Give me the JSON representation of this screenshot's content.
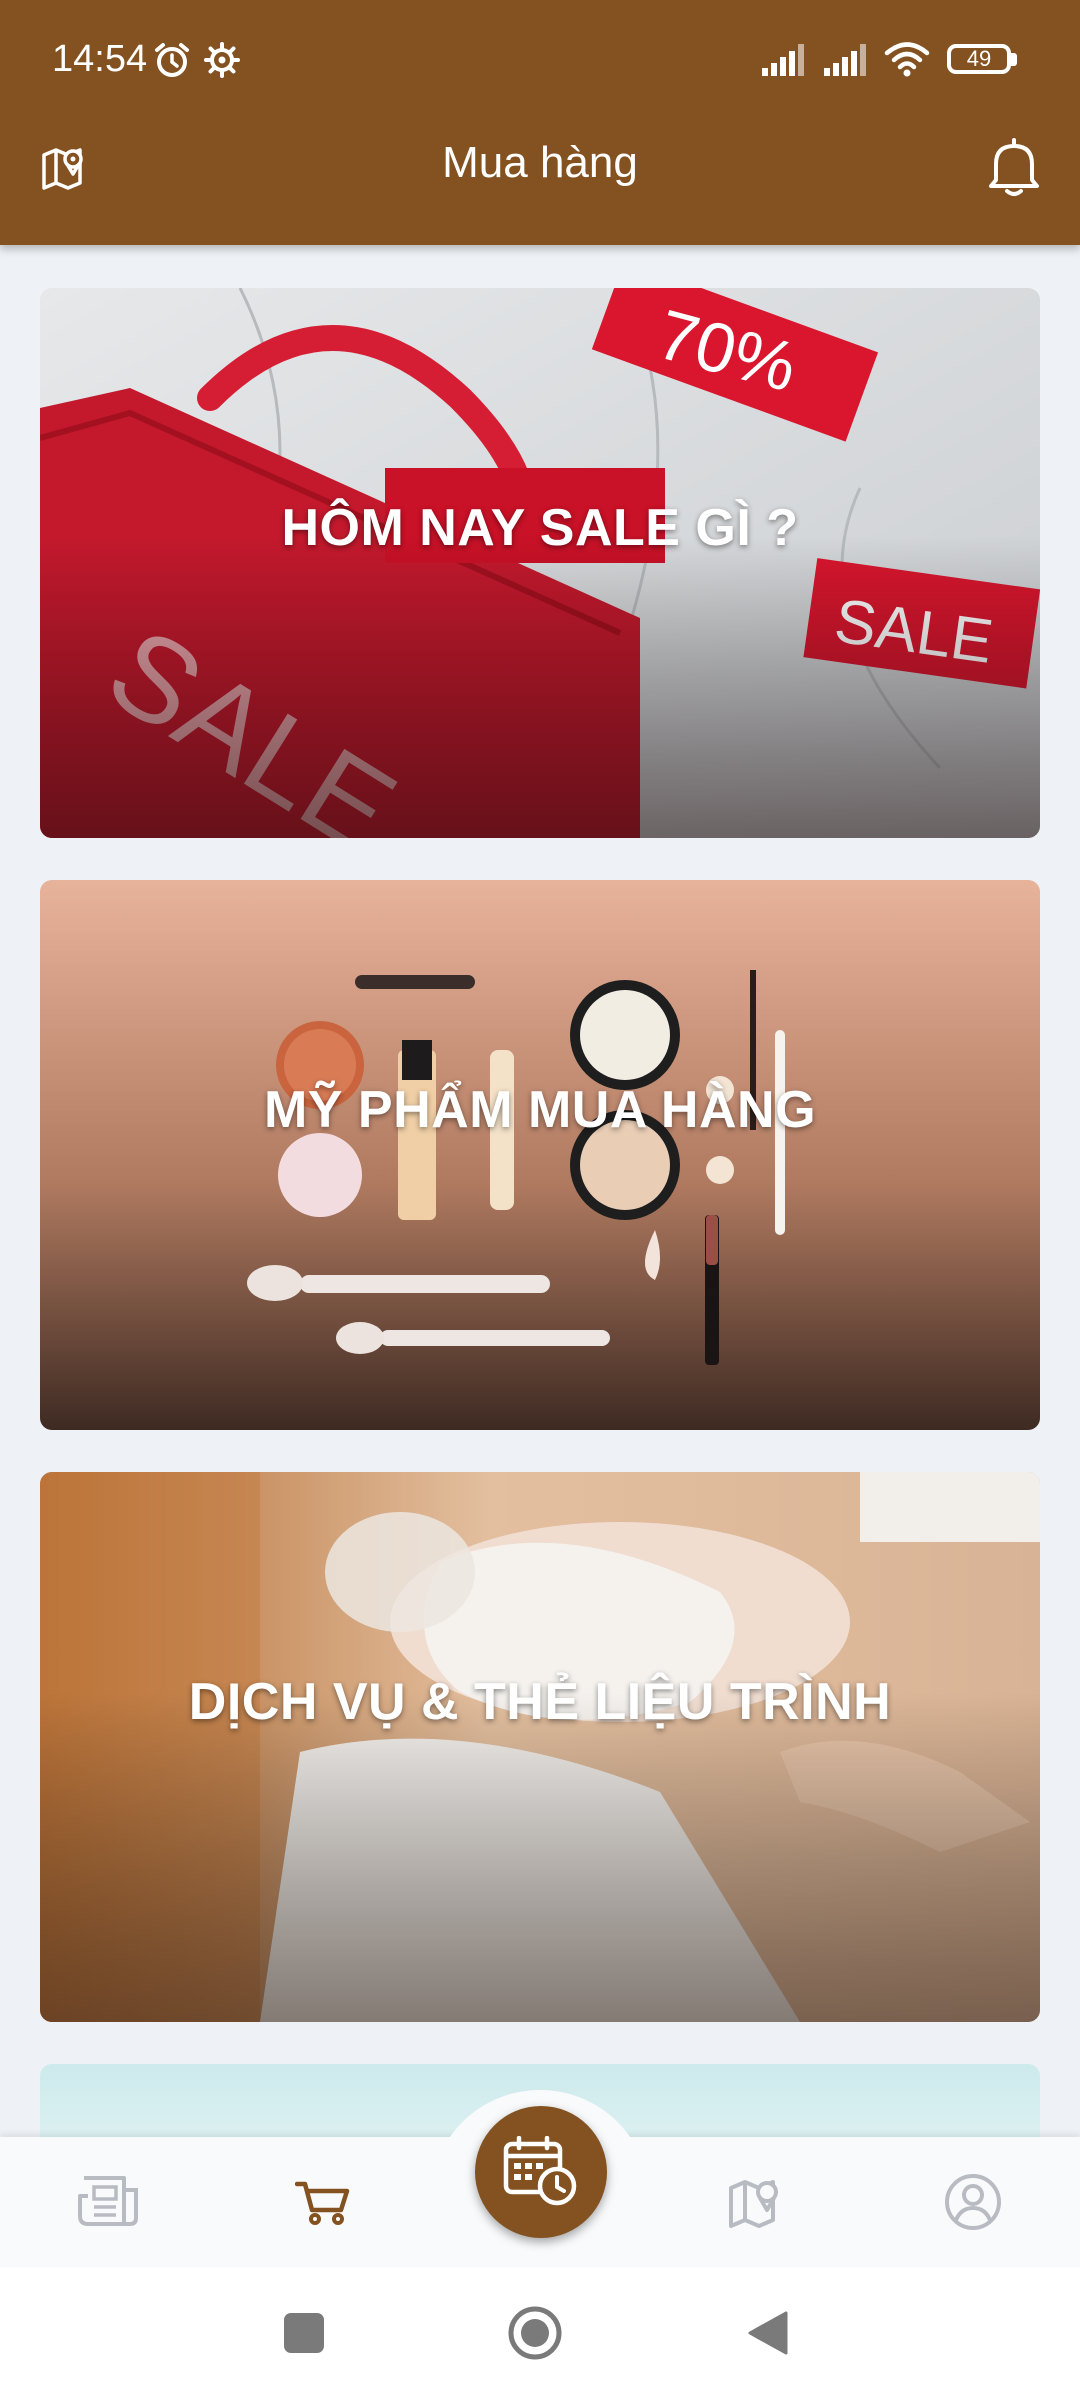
{
  "status": {
    "time": "14:54",
    "battery": "49",
    "icons": [
      "alarm-icon",
      "settings-gear-icon",
      "signal-icon",
      "signal-icon",
      "wifi-icon",
      "battery-icon"
    ]
  },
  "appbar": {
    "title": "Mua hàng",
    "left_icon": "map-pin-icon",
    "right_icon": "bell-icon"
  },
  "cards": [
    {
      "title": "HÔM NAY SALE GÌ ?"
    },
    {
      "title": "MỸ PHẨM MUA HÀNG"
    },
    {
      "title": "DỊCH VỤ & THẺ LIỆU TRÌNH"
    }
  ],
  "bottom_nav": {
    "items": [
      {
        "icon": "newspaper-icon",
        "active": false
      },
      {
        "icon": "cart-icon",
        "active": true
      },
      {
        "icon": "calendar-clock-icon",
        "active": false,
        "center": true
      },
      {
        "icon": "map-pin-icon",
        "active": false
      },
      {
        "icon": "account-icon",
        "active": false
      }
    ]
  },
  "system_nav": [
    "recents-icon",
    "home-icon",
    "back-icon"
  ],
  "colors": {
    "brand": "#835220",
    "background": "#eef1f5",
    "inactive_icon": "#b8bcc2"
  }
}
